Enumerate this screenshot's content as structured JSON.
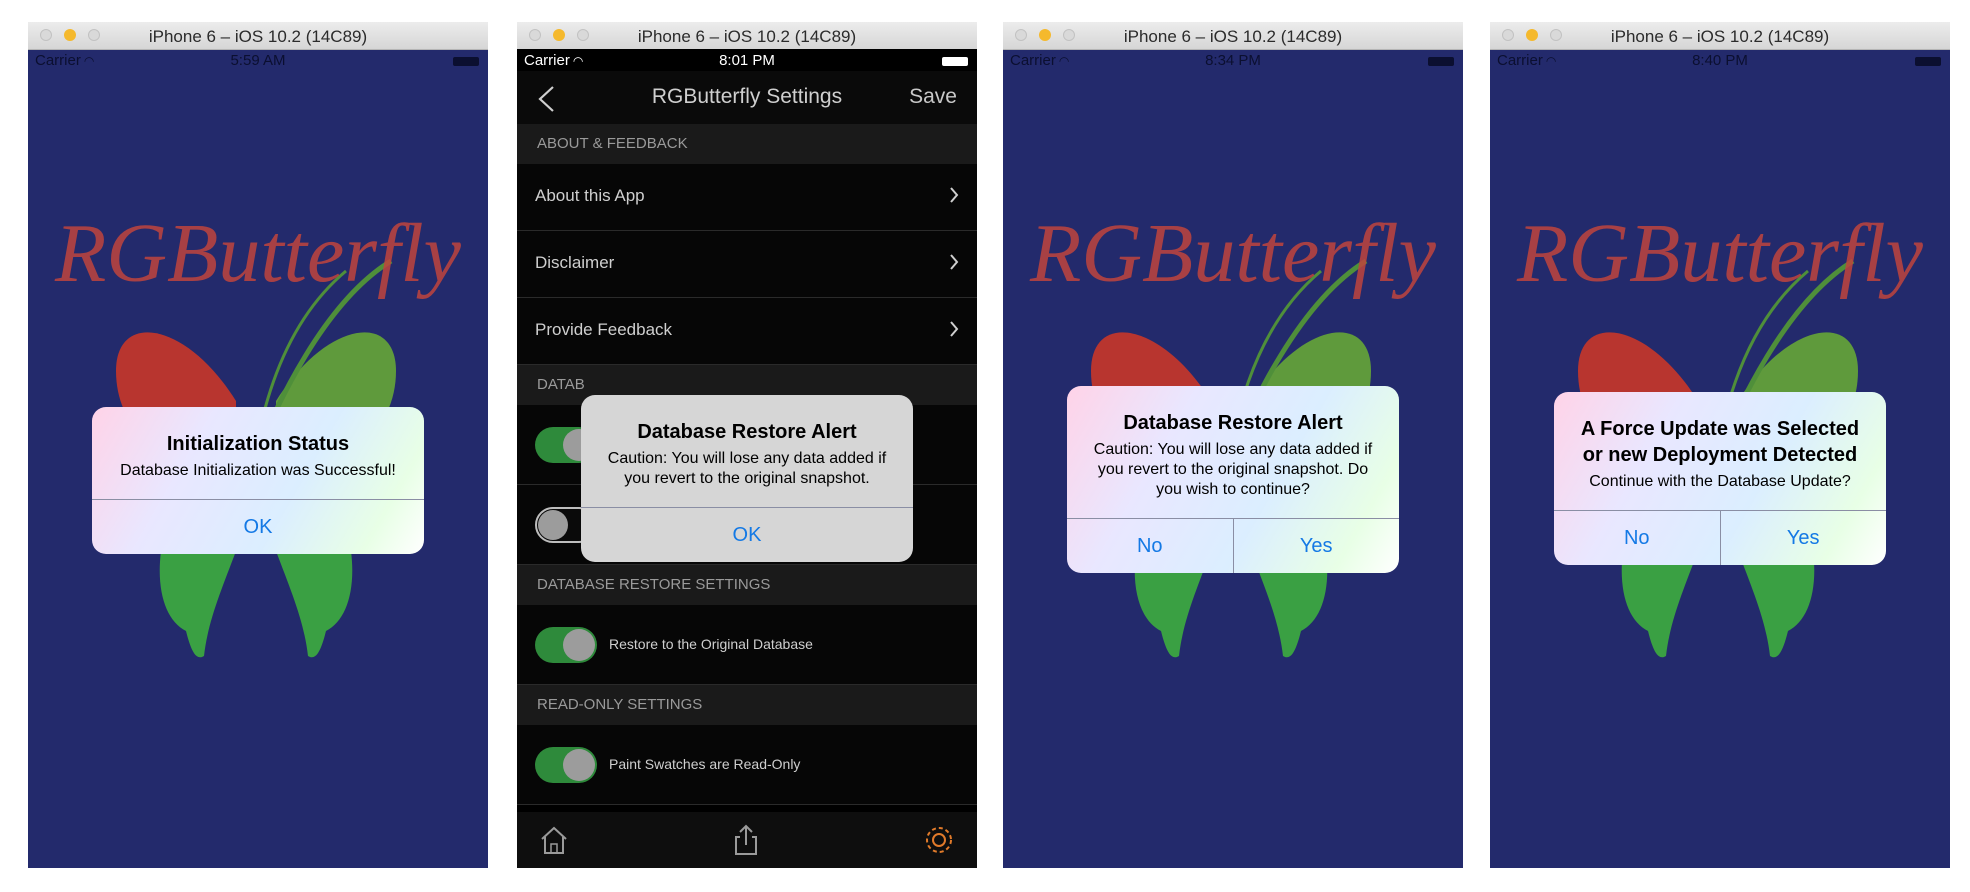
{
  "simulators": [
    {
      "window_title": "iPhone 6 – iOS 10.2 (14C89)",
      "status": {
        "carrier": "Carrier",
        "time": "5:59 AM"
      },
      "alert": {
        "title": "Initialization Status",
        "message": "Database Initialization was Successful!",
        "buttons": [
          "OK"
        ]
      }
    },
    {
      "window_title": "iPhone 6 – iOS 10.2 (14C89)",
      "status": {
        "carrier": "Carrier",
        "time": "8:01 PM"
      },
      "navbar": {
        "title": "RGButterfly Settings",
        "save": "Save"
      },
      "sections": {
        "about": "ABOUT & FEEDBACK",
        "database_partial": "DATAB",
        "restore": "DATABASE RESTORE SETTINGS",
        "readonly": "READ-ONLY SETTINGS"
      },
      "rows": {
        "about_app": "About this App",
        "disclaimer": "Disclaimer",
        "feedback": "Provide Feedback"
      },
      "toggles": {
        "restore": "Restore to the Original Database",
        "readonly": "Paint Swatches are Read-Only"
      },
      "alert": {
        "title": "Database Restore Alert",
        "message": "Caution: You will lose any data added if you revert to the original snapshot.",
        "buttons": [
          "OK"
        ]
      }
    },
    {
      "window_title": "iPhone 6 – iOS 10.2 (14C89)",
      "status": {
        "carrier": "Carrier",
        "time": "8:34 PM"
      },
      "alert": {
        "title": "Database Restore Alert",
        "message": "Caution: You will lose any data added if you revert to the original snapshot. Do you wish to continue?",
        "buttons": [
          "No",
          "Yes"
        ]
      }
    },
    {
      "window_title": "iPhone 6 – iOS 10.2 (14C89)",
      "status": {
        "carrier": "Carrier",
        "time": "8:40 PM"
      },
      "alert": {
        "title": "A Force Update was Selected or new Deployment Detected",
        "message": "Continue with the Database Update?",
        "buttons": [
          "No",
          "Yes"
        ]
      }
    }
  ],
  "logo_text": "RGButterfly",
  "colors": {
    "background": "#232a6c",
    "alert_button": "#1479e5",
    "wing_red": "#b8352f",
    "wing_green": "#3aa043",
    "settings_icon": "#e07a2a"
  }
}
